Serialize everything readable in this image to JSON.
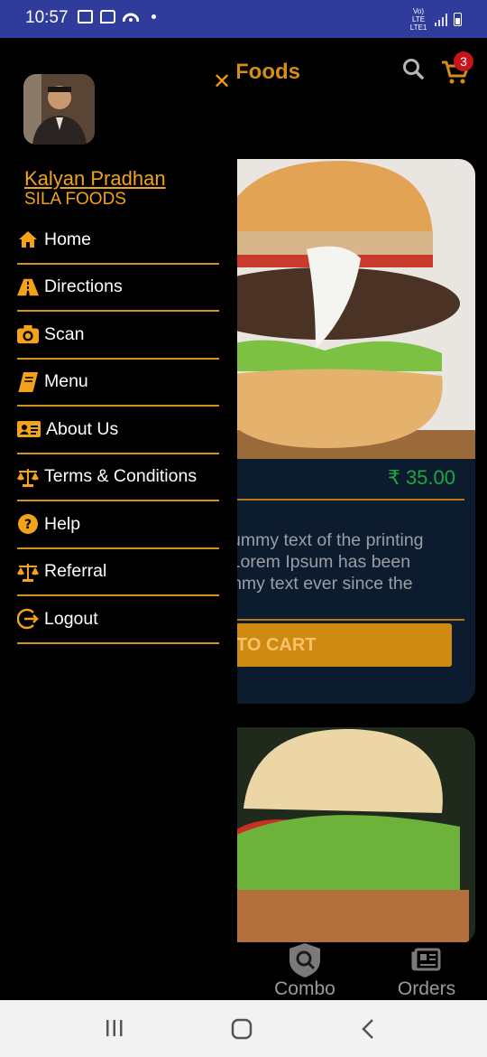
{
  "status_bar": {
    "time": "10:57",
    "network": "Vo) LTE LTE1"
  },
  "header": {
    "title": "Foods",
    "cart_count": "3"
  },
  "product": {
    "price": "₹ 35.00",
    "description_lines": [
      "y dummy text of the printing",
      "ry. Lorem Ipsum has been",
      " dummy text ever since the"
    ],
    "cta": "TO CART"
  },
  "bottom_nav": {
    "combo": "Combo",
    "orders": "Orders"
  },
  "drawer": {
    "user_name": "Kalyan Pradhan",
    "company": "SILA FOODS",
    "items": [
      {
        "label": "Home",
        "icon": "home-icon"
      },
      {
        "label": "Directions",
        "icon": "road-icon"
      },
      {
        "label": "Scan",
        "icon": "camera-icon"
      },
      {
        "label": "Menu",
        "icon": "book-icon"
      },
      {
        "label": "About Us",
        "icon": "id-card-icon"
      },
      {
        "label": "Terms & Conditions",
        "icon": "balance-scale-icon"
      },
      {
        "label": "Help",
        "icon": "question-circle-icon"
      },
      {
        "label": "Referral",
        "icon": "balance-scale-icon"
      },
      {
        "label": "Logout",
        "icon": "logout-icon"
      }
    ]
  },
  "colors": {
    "accent": "#f2a31a",
    "status_bar": "#2f3c9b",
    "price_green": "#1ea542",
    "badge_red": "#c8141b"
  }
}
